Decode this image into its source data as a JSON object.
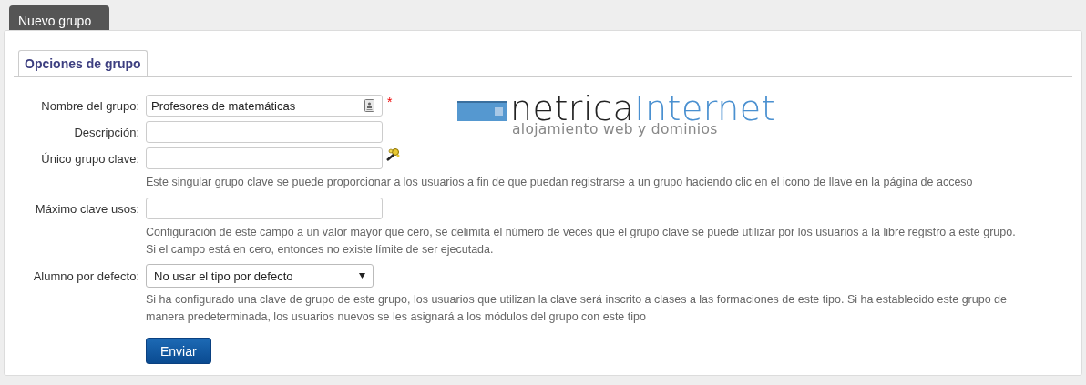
{
  "header_tab": {
    "label": "Nuevo grupo",
    "selected": true
  },
  "section_tab": {
    "label": "Opciones de grupo",
    "selected": true
  },
  "logo": {
    "word_1": "netrica",
    "word_2": "Internet",
    "tagline": "alojamiento web y dominios"
  },
  "fields": [
    {
      "kind": "card_text",
      "label": "Nombre del grupo:",
      "value": "Profesores de matemáticas",
      "required_mark": "*"
    },
    {
      "kind": "text",
      "label": "Descripción:"
    },
    {
      "kind": "key_text",
      "label": "Único grupo clave:",
      "help": [
        "Este singular grupo clave se puede proporcionar a los usuarios a fin de que puedan registrarse a un grupo haciendo clic en el icono de llave en la página de acceso"
      ]
    },
    {
      "kind": "text",
      "label": "Máximo clave usos:",
      "help": [
        "Configuración de este campo a un valor mayor que cero, se delimita el número de veces que el grupo clave se puede utilizar por los usuarios a la libre registro a este grupo.",
        "Si el campo está en cero, entonces no existe límite de ser ejecutada."
      ]
    },
    {
      "kind": "select",
      "label": "Alumno por defecto:",
      "value": "No usar el tipo por defecto",
      "help": [
        "Si ha configurado una clave de grupo de este grupo, los usuarios que utilizan la clave será inscrito a clases a las formaciones de este tipo. Si ha establecido este grupo de manera predeterminada, los usuarios nuevos se les asignará a los módulos del grupo con este tipo"
      ]
    }
  ],
  "submit_button": "Enviar"
}
